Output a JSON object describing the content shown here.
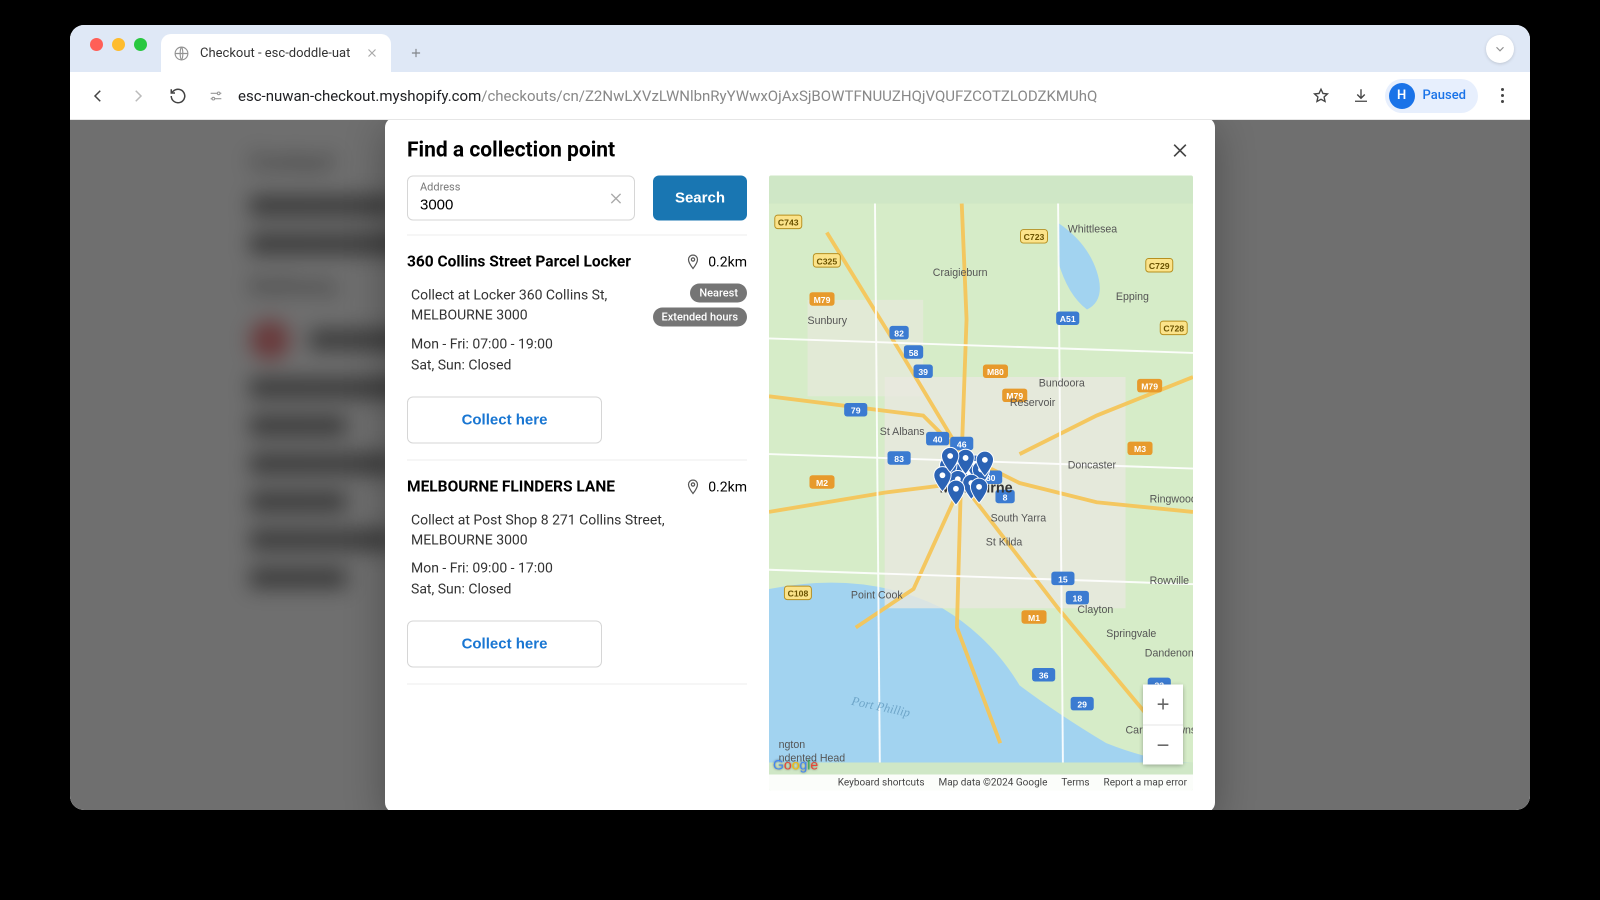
{
  "browser": {
    "tab_title": "Checkout - esc-doddle-uat",
    "url_host": "esc-nuwan-checkout.myshopify.com",
    "url_path": "/checkouts/cn/Z2NwLXVzLWNlbnRyYWwxOjAxSjBOWTFNUUZHQjVQUFZCOTZLODZKMUhQ",
    "profile_initial": "H",
    "profile_label": "Paused"
  },
  "background": {
    "contact_heading": "Contact",
    "delivery_heading": "Delivery"
  },
  "modal": {
    "title": "Find a collection point",
    "address_label": "Address",
    "address_value": "3000",
    "search_label": "Search"
  },
  "results": [
    {
      "name": "360 Collins Street Parcel Locker",
      "distance": "0.2km",
      "badges": [
        "Nearest",
        "Extended hours"
      ],
      "address": "Collect at Locker 360 Collins St, MELBOURNE 3000",
      "hours_weekday": "Mon - Fri: 07:00 - 19:00",
      "hours_weekend": "Sat, Sun: Closed",
      "button": "Collect here"
    },
    {
      "name": "MELBOURNE FLINDERS LANE",
      "distance": "0.2km",
      "badges": [],
      "address": "Collect at Post Shop 8 271 Collins Street, MELBOURNE 3000",
      "hours_weekday": "Mon - Fri: 09:00 - 17:00",
      "hours_weekend": "Sat, Sun: Closed",
      "button": "Collect here"
    }
  ],
  "map": {
    "labels": [
      "Whittlesea",
      "Craigieburn",
      "Epping",
      "Sunbury",
      "Bundoora",
      "Reservoir",
      "St Albans",
      "Doncaster",
      "Ringwood",
      "Rowville",
      "St Kilda",
      "South Yarra",
      "Clayton",
      "Springvale",
      "Dandenong",
      "Carrum Downs",
      "Point Cook",
      "Port Phillip",
      "Melbourne"
    ],
    "roads": [
      "C743",
      "C325",
      "C723",
      "C729",
      "C728",
      "C108",
      "82",
      "58",
      "39",
      "A51",
      "M79",
      "M80",
      "79",
      "40",
      "46",
      "M2",
      "80",
      "83",
      "8",
      "M3",
      "15",
      "18",
      "M1",
      "36",
      "29",
      "33",
      "M1",
      "M3",
      "M79",
      "M79"
    ],
    "attribution": {
      "shortcuts": "Keyboard shortcuts",
      "data": "Map data ©2024 Google",
      "terms": "Terms",
      "report": "Report a map error"
    }
  }
}
